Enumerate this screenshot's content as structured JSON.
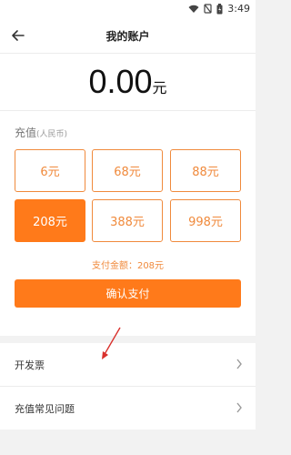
{
  "status": {
    "time": "3:49"
  },
  "header": {
    "title": "我的账户"
  },
  "balance": {
    "amount": "0.00",
    "unit": "元"
  },
  "recharge": {
    "label": "充值",
    "currency": "(人民币)",
    "options": [
      "6元",
      "68元",
      "88元",
      "208元",
      "388元",
      "998元"
    ],
    "selected_index": 3,
    "pay_amount": "支付金额：208元",
    "confirm_label": "确认支付"
  },
  "menu": {
    "invoice": "开发票",
    "faq": "充值常见问题"
  },
  "colors": {
    "accent": "#ff7a1a",
    "accent_outline": "#f08a3c",
    "annotation": "#d9302c"
  }
}
